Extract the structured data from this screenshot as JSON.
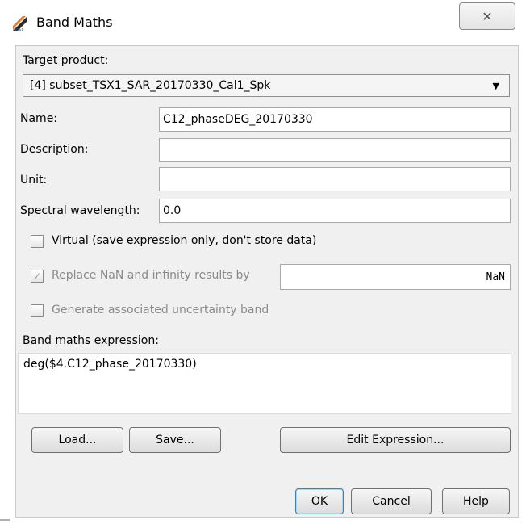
{
  "window": {
    "title": "Band Maths",
    "close_glyph": "✕",
    "icon_name": "band-maths-app-icon"
  },
  "target_product": {
    "label": "Target product:",
    "selected": "[4] subset_TSX1_SAR_20170330_Cal1_Spk"
  },
  "fields": {
    "name_label": "Name:",
    "name_value": "C12_phaseDEG_20170330",
    "description_label": "Description:",
    "description_value": "",
    "unit_label": "Unit:",
    "unit_value": "",
    "wavelength_label": "Spectral wavelength:",
    "wavelength_value": "0.0"
  },
  "options": {
    "virtual_label": "Virtual (save expression only, don't store data)",
    "virtual_checked": false,
    "replace_nan_label": "Replace NaN and infinity results by",
    "replace_nan_checked": true,
    "replace_nan_value": "NaN",
    "uncertainty_label": "Generate associated uncertainty band",
    "uncertainty_checked": false
  },
  "expression": {
    "label": "Band maths expression:",
    "value": "deg($4.C12_phase_20170330)"
  },
  "buttons": {
    "load": "Load...",
    "save": "Save...",
    "edit_expression": "Edit Expression...",
    "ok": "OK",
    "cancel": "Cancel",
    "help": "Help"
  },
  "colors": {
    "dialog_background": "#f0f0f0",
    "default_button_border": "#3c7fb1"
  }
}
